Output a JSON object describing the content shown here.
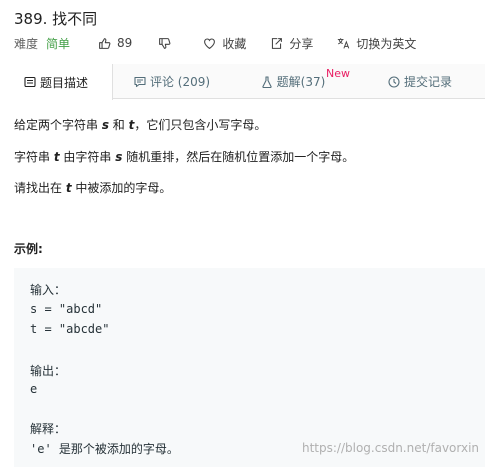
{
  "problem": {
    "title": "389. 找不同"
  },
  "toolbar": {
    "difficulty_label": "难度",
    "difficulty_value": "简单",
    "like_count": "89",
    "favorite_label": "收藏",
    "share_label": "分享",
    "translate_label": "切换为英文"
  },
  "tabs": {
    "description": "题目描述",
    "comments": "评论 (209)",
    "solutions": "题解(37)",
    "solutions_badge": "New",
    "submissions": "提交记录"
  },
  "description": {
    "p1_a": "给定两个字符串 ",
    "p1_s": "s",
    "p1_b": " 和 ",
    "p1_t": "t",
    "p1_c": "，它们只包含小写字母。",
    "p2_a": "字符串 ",
    "p2_t": "t",
    "p2_b": " 由字符串 ",
    "p2_s": "s",
    "p2_c": " 随机重排，然后在随机位置添加一个字母。",
    "p3_a": "请找出在 ",
    "p3_t": "t",
    "p3_b": " 中被添加的字母。"
  },
  "example": {
    "heading": "示例:",
    "input_label": "输入：",
    "line_s": "s = \"abcd\"",
    "line_t": "t = \"abcde\"",
    "output_label": "输出：",
    "output_value": "e",
    "explain_label": "解释：",
    "explain_text": "'e' 是那个被添加的字母。"
  },
  "watermark": "https://blog.csdn.net/favorxin",
  "colors": {
    "difficulty_easy": "#43a047",
    "new_badge": "#e91e63",
    "code_background": "#f7f9fa"
  }
}
